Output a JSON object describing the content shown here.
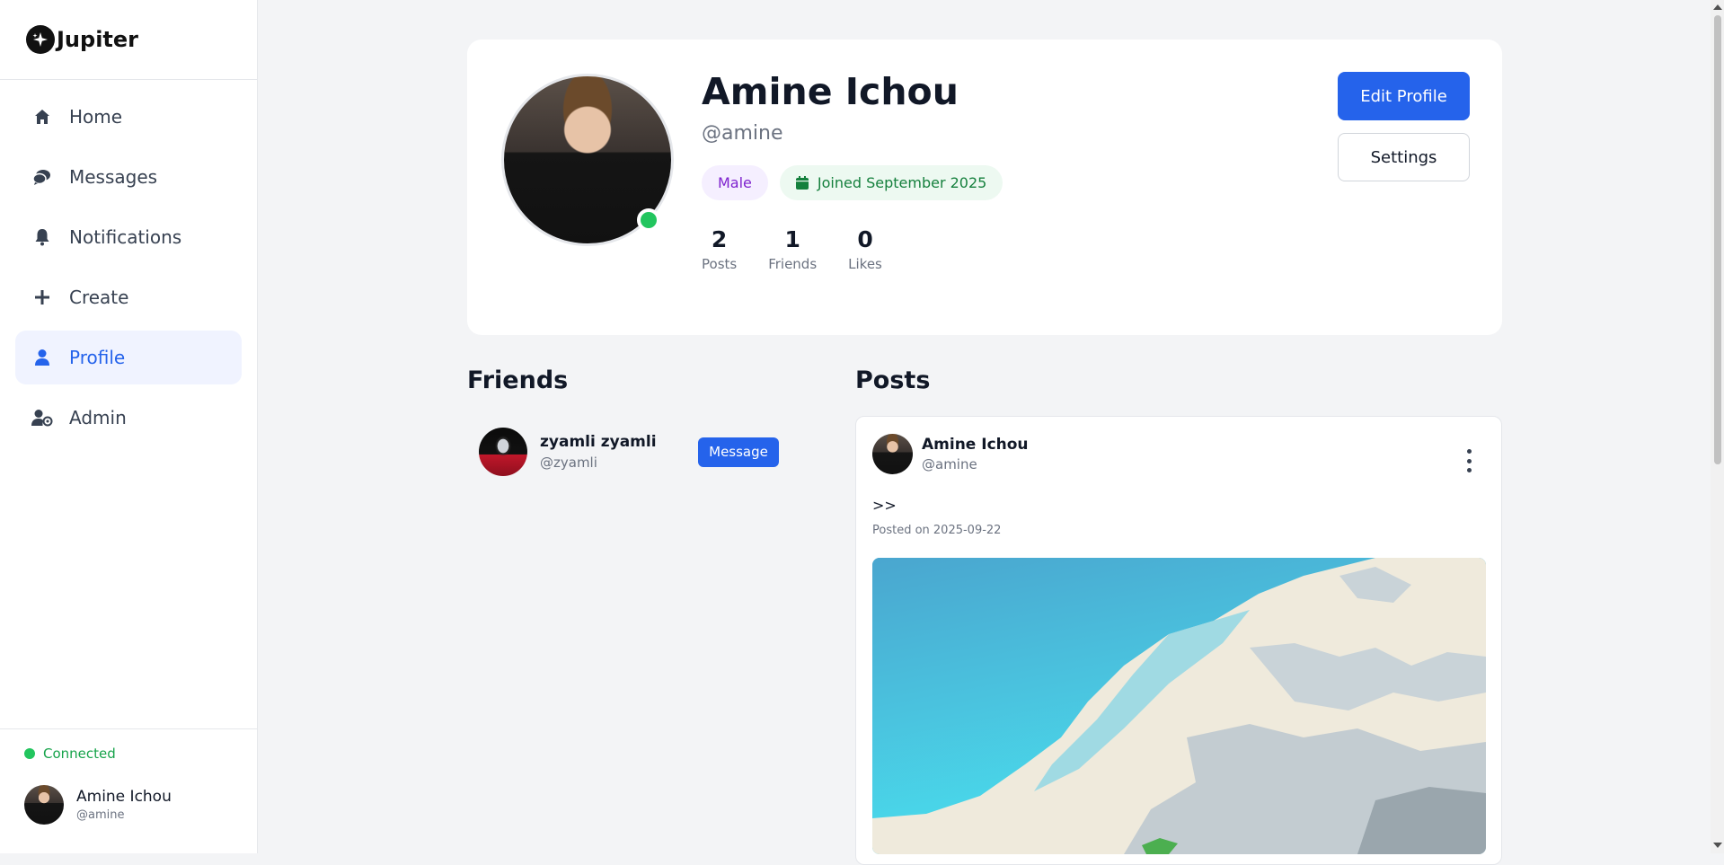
{
  "app": {
    "name": "Jupiter"
  },
  "sidebar": {
    "items": [
      {
        "label": "Home",
        "icon": "home-icon"
      },
      {
        "label": "Messages",
        "icon": "messages-icon"
      },
      {
        "label": "Notifications",
        "icon": "bell-icon"
      },
      {
        "label": "Create",
        "icon": "plus-icon"
      },
      {
        "label": "Profile",
        "icon": "user-icon",
        "active": true
      },
      {
        "label": "Admin",
        "icon": "admin-icon"
      }
    ],
    "status": "Connected",
    "current_user": {
      "name": "Amine Ichou",
      "handle": "@amine"
    }
  },
  "profile": {
    "name": "Amine Ichou",
    "handle": "@amine",
    "gender": "Male",
    "joined": "Joined September 2025",
    "stats": [
      {
        "value": "2",
        "label": "Posts"
      },
      {
        "value": "1",
        "label": "Friends"
      },
      {
        "value": "0",
        "label": "Likes"
      }
    ],
    "edit_label": "Edit Profile",
    "settings_label": "Settings"
  },
  "friends": {
    "title": "Friends",
    "items": [
      {
        "name": "zyamli zyamli",
        "handle": "@zyamli",
        "action": "Message"
      }
    ]
  },
  "posts": {
    "title": "Posts",
    "items": [
      {
        "author": "Amine Ichou",
        "handle": "@amine",
        "text": ">>",
        "date": "Posted on 2025-09-22"
      }
    ]
  },
  "colors": {
    "accent": "#2563eb",
    "online": "#22c55e",
    "gender_badge": "#7e22ce",
    "joined_badge": "#15803d"
  }
}
